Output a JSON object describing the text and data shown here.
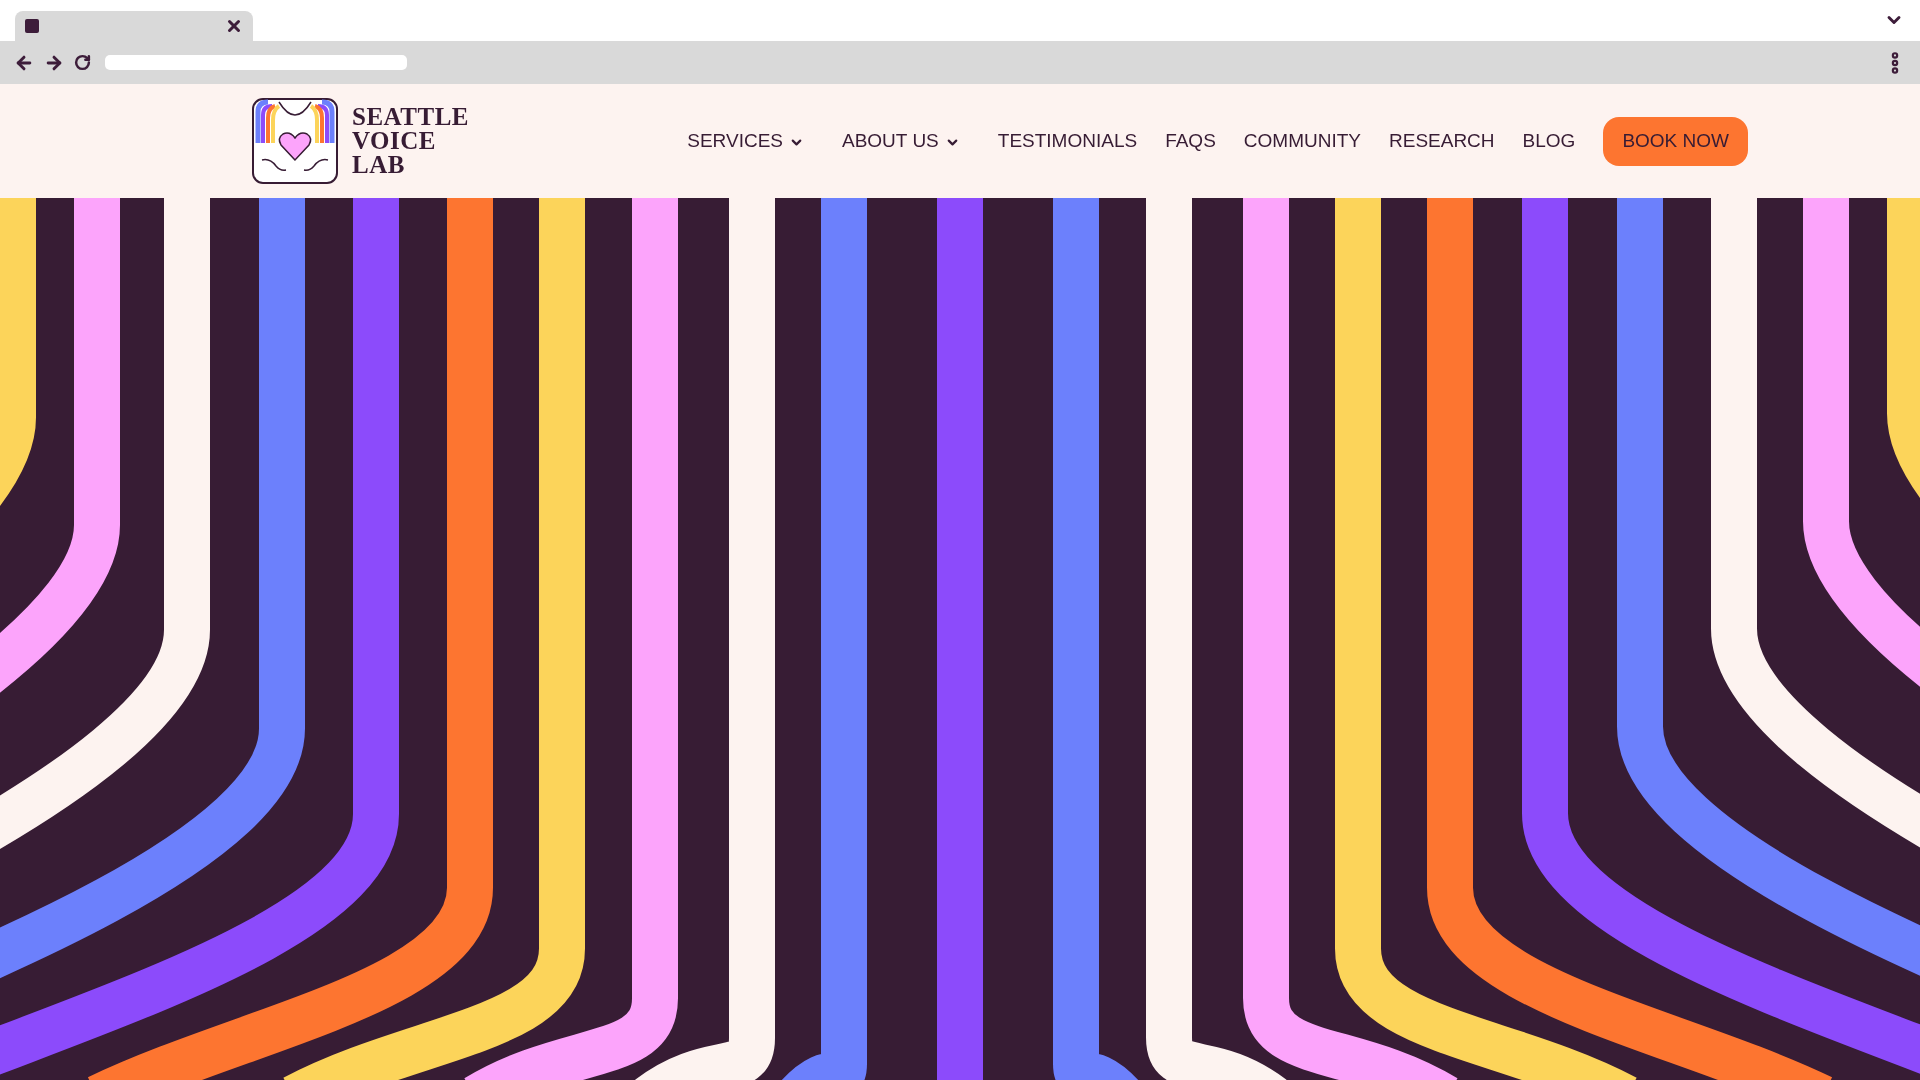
{
  "logo": {
    "lines": [
      "SEATTLE",
      "VOICE",
      "LAB"
    ]
  },
  "nav": [
    {
      "label": "SERVICES",
      "dropdown": true
    },
    {
      "label": "ABOUT US",
      "dropdown": true
    },
    {
      "label": "TESTIMONIALS",
      "dropdown": false
    },
    {
      "label": "FAQS",
      "dropdown": false
    },
    {
      "label": "COMMUNITY",
      "dropdown": false
    },
    {
      "label": "RESEARCH",
      "dropdown": false
    },
    {
      "label": "BLOG",
      "dropdown": false
    }
  ],
  "cta": {
    "label": "BOOK NOW"
  }
}
